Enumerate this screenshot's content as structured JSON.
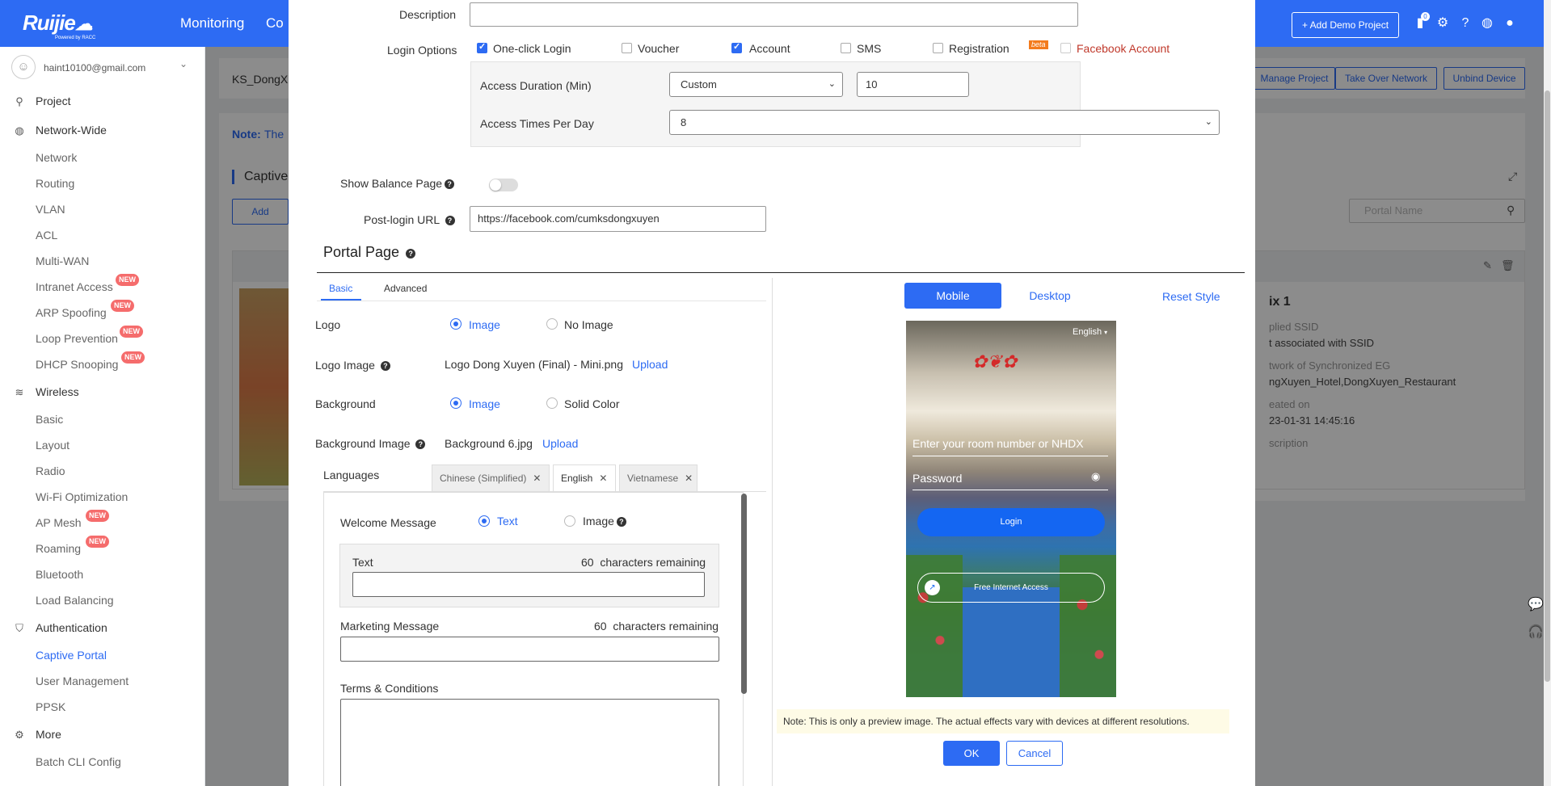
{
  "topbar": {
    "brand": "Ruijie",
    "brand_sub": "Powered by RACC",
    "nav": [
      "Monitoring",
      "Co"
    ],
    "add_demo_project": "+ Add Demo Project",
    "notif_count": "0",
    "icons": [
      "notification-icon",
      "gear-icon",
      "help-icon",
      "globe-icon",
      "user-icon"
    ]
  },
  "sidebar": {
    "user_email": "haint10100@gmail.com",
    "sections": [
      {
        "label": "Project",
        "icon": "project-icon"
      },
      {
        "label": "Network-Wide",
        "icon": "globe-icon"
      },
      {
        "label": "Wireless",
        "icon": "wifi-icon"
      },
      {
        "label": "Authentication",
        "icon": "shield-icon"
      },
      {
        "label": "More",
        "icon": "gear-icon"
      }
    ],
    "network_items": [
      "Network",
      "Routing",
      "VLAN",
      "ACL",
      "Multi-WAN",
      "Intranet Access",
      "ARP Spoofing",
      "Loop Prevention",
      "DHCP Snooping"
    ],
    "wireless_items": [
      "Basic",
      "Layout",
      "Radio",
      "Wi-Fi Optimization",
      "AP Mesh",
      "Roaming",
      "Bluetooth",
      "Load Balancing"
    ],
    "auth_items": [
      "Captive Portal",
      "User Management",
      "PPSK"
    ],
    "more_items": [
      "Batch CLI Config"
    ],
    "new_badge": "NEW"
  },
  "background": {
    "breadcrumb": "KS_DongX",
    "note_label": "Note:",
    "note_text": "The",
    "section_title": "Captive",
    "add_button": "Add",
    "manage_project": "Manage Project",
    "take_over_network": "Take Over Network",
    "unbind_device": "Unbind Device",
    "search_placeholder": "Portal Name",
    "card_title": "ix 1",
    "applied_ssid_label": "plied SSID",
    "applied_ssid_value": "t associated with SSID",
    "sync_eg_label": "twork of Synchronized EG",
    "sync_eg_value": "ngXuyen_Hotel,DongXuyen_Restaurant",
    "created_label": "eated on",
    "created_value": "23-01-31 14:45:16",
    "description_label": "scription"
  },
  "modal": {
    "description_label": "Description",
    "description_value": "",
    "login_options_label": "Login Options",
    "login_options": [
      {
        "label": "One-click Login",
        "checked": true
      },
      {
        "label": "Voucher",
        "checked": false
      },
      {
        "label": "Account",
        "checked": true
      },
      {
        "label": "SMS",
        "checked": false
      },
      {
        "label": "Registration",
        "checked": false
      },
      {
        "label": "Facebook Account",
        "checked": false
      }
    ],
    "beta_badge": "beta",
    "access_duration_label": "Access Duration (Min)",
    "access_duration_select": "Custom",
    "access_duration_value": "10",
    "access_times_label": "Access Times Per Day",
    "access_times_value": "8",
    "show_balance_label": "Show Balance Page",
    "show_balance_on": false,
    "post_login_label": "Post-login URL",
    "post_login_value": "https://facebook.com/cumksdongxuyen",
    "portal_page_title": "Portal Page",
    "tabs": [
      "Basic",
      "Advanced"
    ],
    "logo_label": "Logo",
    "logo_options": [
      "Image",
      "No Image"
    ],
    "logo_image_label": "Logo Image",
    "logo_image_file": "Logo Dong Xuyen (Final) - Mini.png",
    "upload": "Upload",
    "background_label": "Background",
    "background_options": [
      "Image",
      "Solid Color"
    ],
    "background_image_label": "Background Image",
    "background_image_file": "Background 6.jpg",
    "languages_label": "Languages",
    "language_tabs": [
      "Chinese (Simplified)",
      "English",
      "Vietnamese"
    ],
    "welcome_label": "Welcome Message",
    "welcome_options": [
      "Text",
      "Image"
    ],
    "text_label": "Text",
    "text_remaining_count": "60",
    "remaining_suffix": "characters remaining",
    "text_value": "",
    "marketing_label": "Marketing Message",
    "marketing_remaining_count": "60",
    "marketing_value": "",
    "terms_label": "Terms & Conditions",
    "terms_value": "",
    "preview_modes": [
      "Mobile",
      "Desktop"
    ],
    "reset_style": "Reset Style",
    "preview": {
      "language": "English",
      "room_placeholder": "Enter your room number or NHDX",
      "password_placeholder": "Password",
      "login_button": "Login",
      "free_access_button": "Free Internet Access"
    },
    "preview_note": "Note: This is only a preview image. The actual effects vary with devices at different resolutions.",
    "ok_button": "OK",
    "cancel_button": "Cancel"
  }
}
